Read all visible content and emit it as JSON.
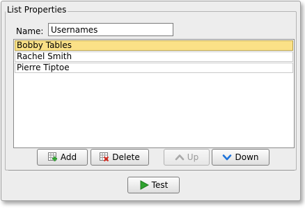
{
  "group": {
    "title": "List Properties"
  },
  "name_field": {
    "label": "Name:",
    "value": "Usernames"
  },
  "list": {
    "items": [
      {
        "label": "Bobby Tables",
        "selected": true
      },
      {
        "label": "Rachel Smith",
        "selected": false
      },
      {
        "label": "Pierre Tiptoe",
        "selected": false
      }
    ]
  },
  "buttons": {
    "add": "Add",
    "delete": "Delete",
    "up": "Up",
    "down": "Down",
    "test": "Test"
  },
  "colors": {
    "selection": "#fbe187",
    "up_arrow_disabled": "#a9a9a9",
    "down_arrow": "#1f73d9",
    "play_icon": "#2ea32e"
  },
  "icons": {
    "add": "add-row-icon",
    "delete": "delete-row-icon",
    "up": "arrow-up-icon",
    "down": "arrow-down-icon",
    "test": "play-icon"
  }
}
